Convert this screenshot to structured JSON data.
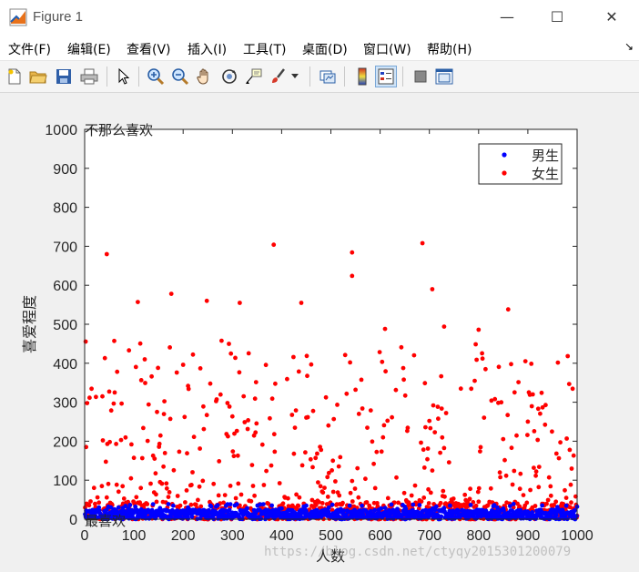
{
  "window": {
    "title": "Figure 1",
    "controls": {
      "minimize": "—",
      "maximize": "☐",
      "close": "✕"
    }
  },
  "menu": {
    "items": [
      "文件(F)",
      "编辑(E)",
      "查看(V)",
      "插入(I)",
      "工具(T)",
      "桌面(D)",
      "窗口(W)",
      "帮助(H)"
    ],
    "dock_arrow": "↘"
  },
  "toolbar": {
    "buttons": [
      "new-figure-icon",
      "open-folder-icon",
      "save-icon",
      "print-icon",
      "pointer-icon",
      "zoom-in-icon",
      "zoom-out-icon",
      "pan-hand-icon",
      "rotate-3d-icon",
      "data-cursor-icon",
      "brush-icon",
      "brush-dropdown-icon",
      "link-plot-icon",
      "colorbar-icon",
      "legend-icon",
      "hide-plot-tools-icon",
      "show-plot-tools-icon"
    ],
    "active": "legend-icon"
  },
  "watermark": "https://blog.csdn.net/ctyqy2015301200079",
  "colors": {
    "male": "#0000ff",
    "female": "#ff0000"
  },
  "chart_data": {
    "type": "scatter",
    "xlabel": "人数",
    "ylabel": "喜爱程度",
    "xlim": [
      0,
      1000
    ],
    "ylim": [
      0,
      1000
    ],
    "xticks": [
      "0",
      "100",
      "200",
      "300",
      "400",
      "500",
      "600",
      "700",
      "800",
      "900",
      "1000"
    ],
    "yticks": [
      "0",
      "100",
      "200",
      "300",
      "400",
      "500",
      "600",
      "700",
      "800",
      "900",
      "1000"
    ],
    "annotations": [
      {
        "text": "不那么喜欢",
        "x": 0,
        "y": 1000
      },
      {
        "text": "最喜欢",
        "x": 0,
        "y": 0
      }
    ],
    "legend_position": "top-right",
    "series": [
      {
        "name": "男生",
        "color": "#0000ff",
        "n": 1000,
        "range": [
          0,
          40
        ],
        "distribution": "uniform-low",
        "points": [
          [
            45,
            24
          ],
          [
            120,
            18
          ],
          [
            210,
            30
          ],
          [
            260,
            12
          ],
          [
            330,
            28
          ],
          [
            380,
            35
          ],
          [
            450,
            20
          ],
          [
            520,
            26
          ],
          [
            600,
            15
          ],
          [
            650,
            32
          ],
          [
            720,
            22
          ],
          [
            800,
            19
          ],
          [
            850,
            27
          ],
          [
            900,
            14
          ],
          [
            960,
            31
          ]
        ]
      },
      {
        "name": "女生",
        "color": "#ff0000",
        "n": 1000,
        "range": [
          0,
          710
        ],
        "distribution": "skewed",
        "points": [
          [
            45,
            680
          ],
          [
            108,
            557
          ],
          [
            176,
            578
          ],
          [
            248,
            560
          ],
          [
            315,
            555
          ],
          [
            384,
            704
          ],
          [
            440,
            555
          ],
          [
            543,
            684
          ],
          [
            543,
            624
          ],
          [
            686,
            708
          ],
          [
            706,
            590
          ],
          [
            860,
            538
          ],
          [
            730,
            494
          ],
          [
            800,
            486
          ],
          [
            610,
            488
          ]
        ]
      }
    ]
  }
}
